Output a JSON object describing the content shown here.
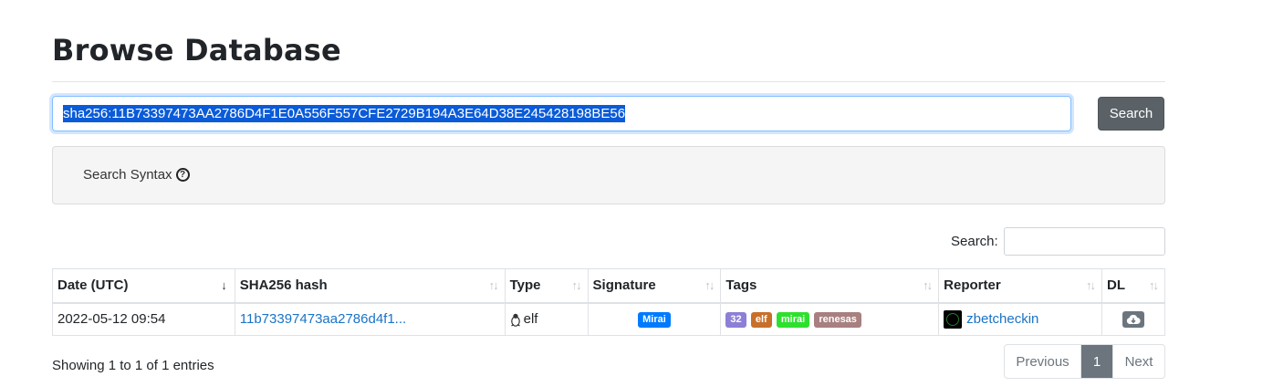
{
  "page_title": "Browse Database",
  "search": {
    "query": "sha256:11B73397473AA2786D4F1E0A556F557CFE2729B194A3E64D38E245428198BE56",
    "button_label": "Search"
  },
  "syntax": {
    "label": "Search Syntax",
    "icon": "question-circle-icon"
  },
  "filter": {
    "label": "Search:",
    "value": ""
  },
  "table": {
    "columns": [
      "Date (UTC)",
      "SHA256 hash",
      "Type",
      "Signature",
      "Tags",
      "Reporter",
      "DL"
    ],
    "sorted_column": "Date (UTC)",
    "rows": [
      {
        "date": "2022-05-12 09:54",
        "sha256": "11b73397473aa2786d4f1...",
        "type": "elf",
        "type_icon": "linux-tux-icon",
        "signature": "Mirai",
        "tags": [
          {
            "label": "32",
            "color": "#8c7fd6"
          },
          {
            "label": "elf",
            "color": "#c8702a"
          },
          {
            "label": "mirai",
            "color": "#2ee02e"
          },
          {
            "label": "renesas",
            "color": "#a88080"
          }
        ],
        "reporter": "zbetcheckin",
        "dl_icon": "cloud-download-icon"
      }
    ]
  },
  "colors": {
    "signature_badge": "#007bff",
    "button": "#5a6268",
    "link": "#1a73c7"
  },
  "info": "Showing 1 to 1 of 1 entries",
  "pagination": {
    "previous": "Previous",
    "current": "1",
    "next": "Next"
  }
}
